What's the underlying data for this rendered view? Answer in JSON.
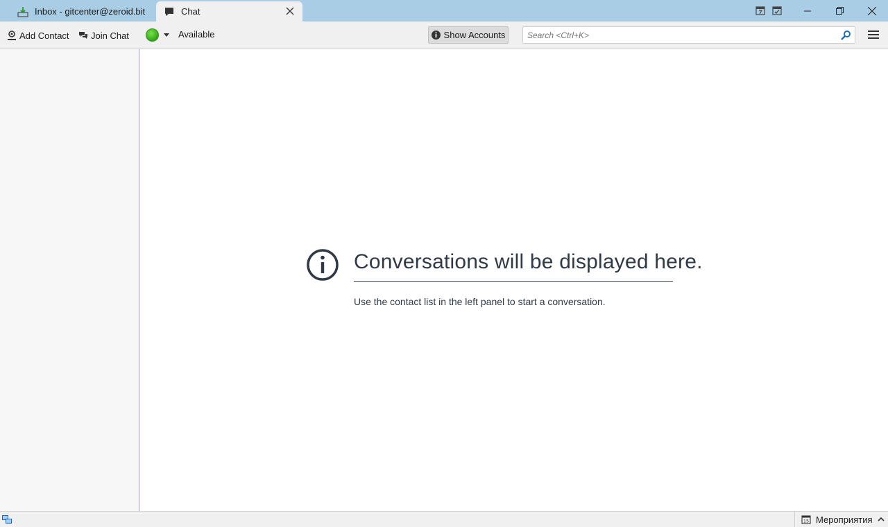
{
  "tabs": [
    {
      "label": "Inbox - gitcenter@zeroid.bit",
      "icon": "inbox-download-icon"
    },
    {
      "label": "Chat",
      "icon": "chat-bubble-icon"
    }
  ],
  "toolbar": {
    "add_contact": "Add Contact",
    "join_chat": "Join Chat",
    "status": "Available",
    "status_color": "#3cb81f",
    "show_accounts": "Show Accounts",
    "search_placeholder": "Search <Ctrl+K>"
  },
  "main": {
    "headline": "Conversations will be displayed here.",
    "subtext": "Use the contact list in the left panel to start a conversation."
  },
  "statusbar": {
    "events_label": "Мероприятия"
  },
  "colors": {
    "tabbar_bg": "#a8cde4",
    "text_dark": "#2f3a46"
  }
}
